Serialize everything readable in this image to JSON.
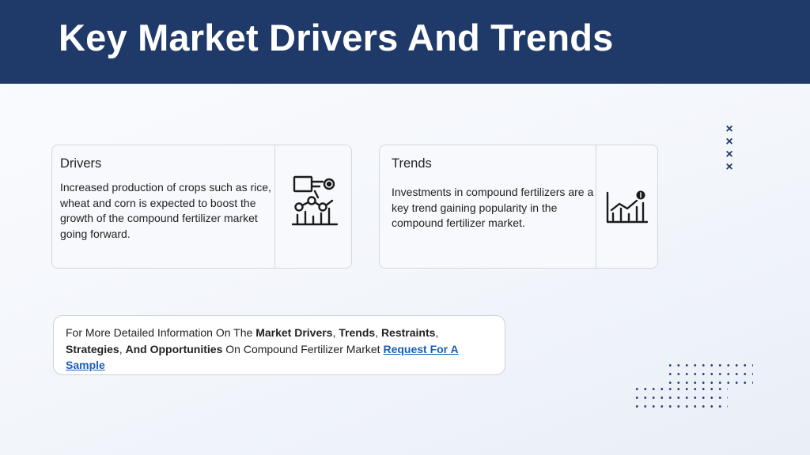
{
  "header": {
    "title": "Key Market Drivers And Trends"
  },
  "drivers_card": {
    "heading": "Drivers",
    "body": "Increased production of crops such as rice, wheat and corn is expected to boost the growth of the compound fertilizer market going forward.",
    "icon": "plant-growth-chart-icon"
  },
  "trends_card": {
    "heading": "Trends",
    "body": "Investments in compound fertilizers are a key trend gaining popularity in the compound fertilizer market.",
    "icon": "investment-trend-chart-icon"
  },
  "info_box": {
    "prefix": "For More Detailed Information On The ",
    "term1": "Market Drivers",
    "sep1": ", ",
    "term2": "Trends",
    "sep2": ", ",
    "term3": "Restraints",
    "sep3": ", ",
    "term4": "Strategies",
    "sep4": ", ",
    "term5": "And Opportunities",
    "middle": " On Compound Fertilizer Market  ",
    "link_label": "Request For A Sample"
  },
  "colors": {
    "header_bg": "#1f3a68",
    "accent": "#1f3a68",
    "link": "#1a5fb4"
  }
}
